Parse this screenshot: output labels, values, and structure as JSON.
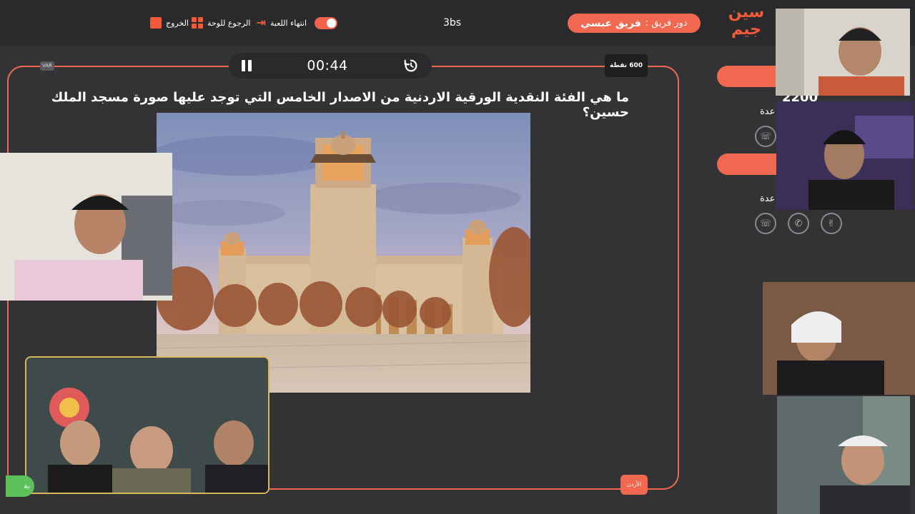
{
  "topbar": {
    "exit_label": "الخروج",
    "board_label": "الرجوع للوحة",
    "end_game_label": "انتهاء اللعبة",
    "room_code": "3bs",
    "turn_prefix": "دور فريق :",
    "turn_team": "فريق عبسي",
    "logo_line1": "سين",
    "logo_line2": "جيم"
  },
  "question_panel": {
    "timer": "00:44",
    "var_badge": "VAR",
    "points": "600 نقطة",
    "question": "ما هي الفئة النقدية الورقية الاردنية من الاصدار الخامس التي توجد عليها صورة مسجد الملك حسين؟",
    "country_tag": "الأردن"
  },
  "teams_panel": {
    "score": "2200",
    "aid_label_1": "عدة",
    "aid_label_2": "عدة",
    "green_label": "بة"
  },
  "colors": {
    "accent": "#f0684f",
    "background": "#333336",
    "topbar": "#2a2a2d"
  },
  "icons": [
    "exit-icon",
    "board-icon",
    "end-game-icon",
    "toggle-switch",
    "pause-icon",
    "reset-timer-icon",
    "call-friend-icon",
    "phone-icon",
    "hands-icon"
  ]
}
